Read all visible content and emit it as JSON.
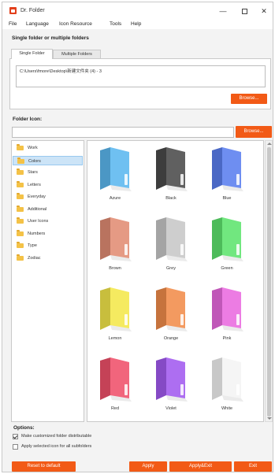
{
  "window": {
    "title": "Dr. Folder",
    "minimize_glyph": "—",
    "close_glyph": "✕"
  },
  "menu": [
    "File",
    "Language",
    "Icon Resource",
    "Tools",
    "Help"
  ],
  "folders_section": {
    "heading": "Single folder or multiple folders",
    "tabs": [
      {
        "label": "Single Folder",
        "active": true
      },
      {
        "label": "Multiple Folders",
        "active": false
      }
    ],
    "path_value": "C:\\Users\\fmore\\Desktop\\新建文件夹 (4) - 3",
    "browse_label": "Browse..."
  },
  "folder_icon_section": {
    "heading": "Folder Icon:",
    "input_value": "",
    "browse_label": "Browse..."
  },
  "categories": [
    {
      "label": "Work",
      "selected": false
    },
    {
      "label": "Colors",
      "selected": true
    },
    {
      "label": "Stars",
      "selected": false
    },
    {
      "label": "Letters",
      "selected": false
    },
    {
      "label": "Everyday",
      "selected": false
    },
    {
      "label": "Additional",
      "selected": false
    },
    {
      "label": "User Icons",
      "selected": false
    },
    {
      "label": "Numbers",
      "selected": false
    },
    {
      "label": "Type",
      "selected": false
    },
    {
      "label": "Zodiac",
      "selected": false
    }
  ],
  "icons": [
    {
      "label": "Azure",
      "color": "#5cb8f0"
    },
    {
      "label": "Black",
      "color": "#4a4a4a"
    },
    {
      "label": "Blue",
      "color": "#5a7ff0"
    },
    {
      "label": "Brown",
      "color": "#e28c74"
    },
    {
      "label": "Grey",
      "color": "#c8c8c8"
    },
    {
      "label": "Green",
      "color": "#5ee46e"
    },
    {
      "label": "Lemon",
      "color": "#f4e84a"
    },
    {
      "label": "Orange",
      "color": "#f28c4a"
    },
    {
      "label": "Pink",
      "color": "#ea6ae0"
    },
    {
      "label": "Red",
      "color": "#f0506a"
    },
    {
      "label": "Violet",
      "color": "#a25af0"
    },
    {
      "label": "White",
      "color": "#f4f4f4"
    }
  ],
  "options": {
    "heading": "Options:",
    "items": [
      {
        "label": "Make customized folder distributable",
        "checked": true
      },
      {
        "label": "Apply selected icon for all subfolders",
        "checked": false
      }
    ]
  },
  "footer": {
    "reset_label": "Reset to default",
    "apply_label": "Apply",
    "apply_exit_label": "Apply&Exit",
    "exit_label": "Exit"
  },
  "accent_color": "#f25a16"
}
